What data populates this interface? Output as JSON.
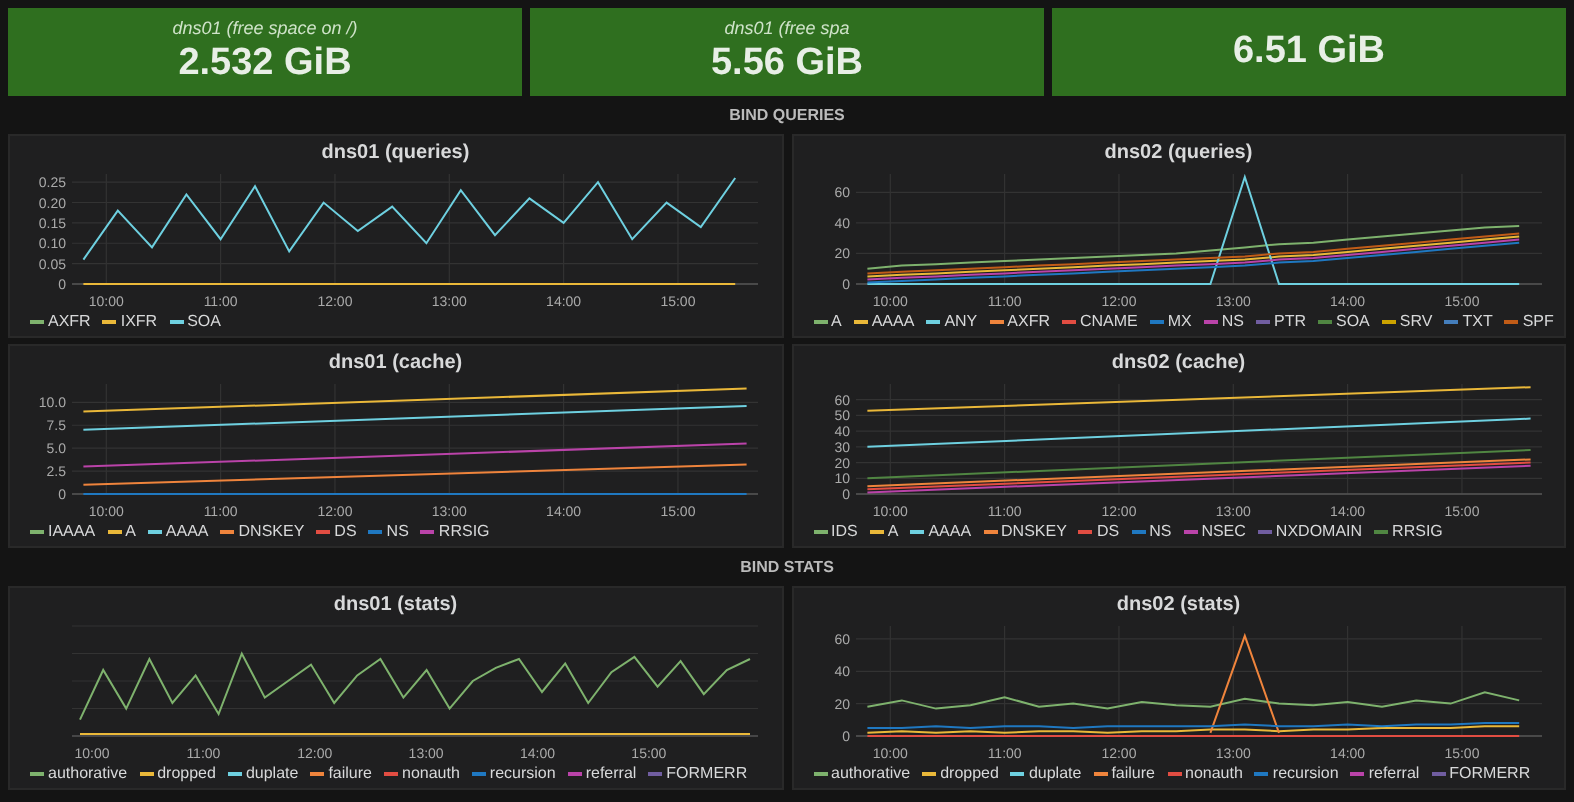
{
  "stat_panels": [
    {
      "title": "dns01 (free space on /)",
      "value": "2.532 GiB"
    },
    {
      "title": "dns01 (free spa",
      "value": "5.56 GiB"
    },
    {
      "value": "6.51 GiB"
    }
  ],
  "rows": [
    {
      "title": "BIND QUERIES",
      "panels": [
        {
          "chart_data": {
            "type": "line",
            "grid": true,
            "title": "dns01 (queries)",
            "x": [
              9.8,
              10.1,
              10.4,
              10.7,
              11,
              11.3,
              11.6,
              11.9,
              12.2,
              12.5,
              12.8,
              13.1,
              13.4,
              13.7,
              14,
              14.3,
              14.6,
              14.9,
              15.2,
              15.5
            ],
            "xlim": [
              9.7,
              15.7
            ],
            "ylim": [
              0,
              0.27
            ],
            "xticks": [
              {
                "value": 10,
                "label": "10:00"
              },
              {
                "value": 11,
                "label": "11:00"
              },
              {
                "value": 12,
                "label": "12:00"
              },
              {
                "value": 13,
                "label": "13:00"
              },
              {
                "value": 14,
                "label": "14:00"
              },
              {
                "value": 15,
                "label": "15:00"
              }
            ],
            "yticks": [
              0,
              {
                "value": 0.05,
                "label": "0.05"
              },
              {
                "value": 0.1,
                "label": "0.10"
              },
              {
                "value": 0.15,
                "label": "0.15"
              },
              {
                "value": 0.2,
                "label": "0.20"
              },
              {
                "value": 0.25,
                "label": "0.25"
              }
            ],
            "series": [
              {
                "name": "AXFR",
                "color": "#7eb26d",
                "values": [
                  null,
                  null,
                  null,
                  null,
                  null,
                  null,
                  null,
                  null,
                  null,
                  null,
                  null,
                  null,
                  null,
                  null,
                  null,
                  null,
                  null,
                  null,
                  null,
                  null
                ]
              },
              {
                "name": "IXFR",
                "color": "#eab839",
                "values": [
                  0,
                  0,
                  0,
                  0,
                  0,
                  0,
                  0,
                  0,
                  0,
                  0,
                  0,
                  0,
                  0,
                  0,
                  0,
                  0,
                  0,
                  0,
                  0,
                  0
                ]
              },
              {
                "name": "SOA",
                "color": "#6ed0e0",
                "values": [
                  0.06,
                  0.18,
                  0.09,
                  0.22,
                  0.11,
                  0.24,
                  0.08,
                  0.2,
                  0.13,
                  0.19,
                  0.1,
                  0.23,
                  0.12,
                  0.21,
                  0.15,
                  0.25,
                  0.11,
                  0.2,
                  0.14,
                  0.26
                ]
              }
            ]
          }
        },
        {
          "chart_data": {
            "type": "line",
            "grid": true,
            "title": "dns02 (queries)",
            "x": [
              9.8,
              10.1,
              10.4,
              10.7,
              11,
              11.3,
              11.6,
              11.9,
              12.2,
              12.5,
              12.8,
              13.1,
              13.4,
              13.7,
              14,
              14.3,
              14.6,
              14.9,
              15.2,
              15.5
            ],
            "xlim": [
              9.7,
              15.7
            ],
            "ylim": [
              0,
              72
            ],
            "xticks": [
              {
                "value": 10,
                "label": "10:00"
              },
              {
                "value": 11,
                "label": "11:00"
              },
              {
                "value": 12,
                "label": "12:00"
              },
              {
                "value": 13,
                "label": "13:00"
              },
              {
                "value": 14,
                "label": "14:00"
              },
              {
                "value": 15,
                "label": "15:00"
              }
            ],
            "yticks": [
              0,
              20,
              40,
              60
            ],
            "series": [
              {
                "name": "A",
                "color": "#7eb26d",
                "values": [
                  10,
                  12,
                  13,
                  14,
                  15,
                  16,
                  17,
                  18,
                  19,
                  20,
                  22,
                  24,
                  26,
                  27,
                  29,
                  31,
                  33,
                  35,
                  37,
                  38
                ]
              },
              {
                "name": "AAAA",
                "color": "#eab839",
                "values": [
                  5,
                  6,
                  7,
                  8,
                  9,
                  10,
                  11,
                  12,
                  13,
                  14,
                  15,
                  16,
                  18,
                  19,
                  21,
                  23,
                  25,
                  27,
                  29,
                  31
                ]
              },
              {
                "name": "ANY",
                "color": "#6ed0e0",
                "values": [
                  0,
                  0,
                  0,
                  0,
                  0,
                  0,
                  0,
                  0,
                  0,
                  0,
                  0,
                  70,
                  0,
                  0,
                  0,
                  0,
                  0,
                  0,
                  0,
                  0
                ]
              },
              {
                "name": "AXFR",
                "color": "#ef843c",
                "values": [
                  null,
                  null,
                  null,
                  null,
                  null,
                  null,
                  null,
                  null,
                  null,
                  null,
                  null,
                  null,
                  null,
                  null,
                  null,
                  null,
                  null,
                  null,
                  null,
                  null
                ]
              },
              {
                "name": "CNAME",
                "color": "#e24d42",
                "values": [
                  null,
                  null,
                  null,
                  null,
                  null,
                  null,
                  null,
                  null,
                  null,
                  null,
                  null,
                  null,
                  null,
                  null,
                  null,
                  null,
                  null,
                  null,
                  null,
                  null
                ]
              },
              {
                "name": "MX",
                "color": "#1f78c1",
                "values": [
                  1,
                  2,
                  3,
                  4,
                  5,
                  6,
                  7,
                  8,
                  9,
                  10,
                  11,
                  12,
                  14,
                  15,
                  17,
                  19,
                  21,
                  23,
                  25,
                  27
                ]
              },
              {
                "name": "NS",
                "color": "#ba43a9",
                "values": [
                  3,
                  4,
                  5,
                  6,
                  7,
                  8,
                  9,
                  10,
                  11,
                  12,
                  13,
                  14,
                  16,
                  17,
                  19,
                  21,
                  23,
                  25,
                  27,
                  29
                ]
              },
              {
                "name": "PTR",
                "color": "#705da0",
                "values": [
                  null,
                  null,
                  null,
                  null,
                  null,
                  null,
                  null,
                  null,
                  null,
                  null,
                  null,
                  null,
                  null,
                  null,
                  null,
                  null,
                  null,
                  null,
                  null,
                  null
                ]
              },
              {
                "name": "SOA",
                "color": "#508642",
                "values": [
                  null,
                  null,
                  null,
                  null,
                  null,
                  null,
                  null,
                  null,
                  null,
                  null,
                  null,
                  null,
                  null,
                  null,
                  null,
                  null,
                  null,
                  null,
                  null,
                  null
                ]
              },
              {
                "name": "SRV",
                "color": "#cca300",
                "values": [
                  null,
                  null,
                  null,
                  null,
                  null,
                  null,
                  null,
                  null,
                  null,
                  null,
                  null,
                  null,
                  null,
                  null,
                  null,
                  null,
                  null,
                  null,
                  null,
                  null
                ]
              },
              {
                "name": "TXT",
                "color": "#447ebc",
                "values": [
                  null,
                  null,
                  null,
                  null,
                  null,
                  null,
                  null,
                  null,
                  null,
                  null,
                  null,
                  null,
                  null,
                  null,
                  null,
                  null,
                  null,
                  null,
                  null,
                  null
                ]
              },
              {
                "name": "SPF",
                "color": "#c15c17",
                "values": [
                  7,
                  8,
                  9,
                  10,
                  11,
                  12,
                  13,
                  14,
                  15,
                  16,
                  17,
                  18,
                  20,
                  21,
                  23,
                  25,
                  27,
                  29,
                  31,
                  33
                ]
              }
            ]
          }
        }
      ]
    },
    {
      "panels": [
        {
          "chart_data": {
            "type": "line",
            "grid": true,
            "title": "dns01 (cache)",
            "x": [
              9.8,
              15.6
            ],
            "xlim": [
              9.7,
              15.7
            ],
            "ylim": [
              0,
              12
            ],
            "xticks": [
              {
                "value": 10,
                "label": "10:00"
              },
              {
                "value": 11,
                "label": "11:00"
              },
              {
                "value": 12,
                "label": "12:00"
              },
              {
                "value": 13,
                "label": "13:00"
              },
              {
                "value": 14,
                "label": "14:00"
              },
              {
                "value": 15,
                "label": "15:00"
              }
            ],
            "yticks": [
              0,
              {
                "value": 2.5,
                "label": "2.5"
              },
              {
                "value": 5,
                "label": "5.0"
              },
              {
                "value": 7.5,
                "label": "7.5"
              },
              {
                "value": 10,
                "label": "10.0"
              }
            ],
            "series": [
              {
                "name": "IAAAA",
                "color": "#7eb26d",
                "values": [
                  null,
                  null
                ]
              },
              {
                "name": "A",
                "color": "#eab839",
                "values": [
                  9,
                  11.5
                ]
              },
              {
                "name": "AAAA",
                "color": "#6ed0e0",
                "values": [
                  7,
                  9.6
                ]
              },
              {
                "name": "DNSKEY",
                "color": "#ef843c",
                "values": [
                  1,
                  3.2
                ]
              },
              {
                "name": "DS",
                "color": "#e24d42",
                "values": [
                  null,
                  null
                ]
              },
              {
                "name": "NS",
                "color": "#1f78c1",
                "values": [
                  0,
                  0
                ]
              },
              {
                "name": "RRSIG",
                "color": "#ba43a9",
                "values": [
                  3,
                  5.5
                ]
              }
            ]
          }
        },
        {
          "chart_data": {
            "type": "line",
            "grid": true,
            "title": "dns02 (cache)",
            "x": [
              9.8,
              15.6
            ],
            "xlim": [
              9.7,
              15.7
            ],
            "ylim": [
              0,
              70
            ],
            "xticks": [
              {
                "value": 10,
                "label": "10:00"
              },
              {
                "value": 11,
                "label": "11:00"
              },
              {
                "value": 12,
                "label": "12:00"
              },
              {
                "value": 13,
                "label": "13:00"
              },
              {
                "value": 14,
                "label": "14:00"
              },
              {
                "value": 15,
                "label": "15:00"
              }
            ],
            "yticks": [
              0,
              10,
              20,
              30,
              40,
              50,
              60
            ],
            "series": [
              {
                "name": "IDS",
                "color": "#7eb26d",
                "values": [
                  null,
                  null
                ]
              },
              {
                "name": "A",
                "color": "#eab839",
                "values": [
                  53,
                  68
                ]
              },
              {
                "name": "AAAA",
                "color": "#6ed0e0",
                "values": [
                  30,
                  48
                ]
              },
              {
                "name": "DNSKEY",
                "color": "#ef843c",
                "values": [
                  5,
                  22
                ]
              },
              {
                "name": "DS",
                "color": "#e24d42",
                "values": [
                  3,
                  20
                ]
              },
              {
                "name": "NS",
                "color": "#1f78c1",
                "values": [
                  null,
                  null
                ]
              },
              {
                "name": "NSEC",
                "color": "#ba43a9",
                "values": [
                  1,
                  18
                ]
              },
              {
                "name": "NXDOMAIN",
                "color": "#705da0",
                "values": [
                  null,
                  null
                ]
              },
              {
                "name": "RRSIG",
                "color": "#508642",
                "values": [
                  10,
                  28
                ]
              }
            ]
          }
        }
      ]
    },
    {
      "title": "BIND STATS",
      "panels": [
        {
          "title": "dns01 (stats)",
          "x_labels": [
            "10:00",
            "11:00",
            "12:00",
            "13:00",
            "14:00",
            "15:00"
          ],
          "legend": [
            {
              "name": "authorative",
              "color": "#7eb26d"
            },
            {
              "name": "dropped",
              "color": "#eab839"
            },
            {
              "name": "duplate",
              "color": "#6ed0e0"
            },
            {
              "name": "failure",
              "color": "#ef843c"
            },
            {
              "name": "nonauth",
              "color": "#e24d42"
            },
            {
              "name": "recursion",
              "color": "#1f78c1"
            },
            {
              "name": "referral",
              "color": "#ba43a9"
            },
            {
              "name": "FORMERR",
              "color": "#705da0"
            }
          ]
        },
        {
          "chart_data": {
            "type": "line",
            "grid": true,
            "title": "dns02 (stats)",
            "x": [
              9.8,
              10.1,
              10.4,
              10.7,
              11,
              11.3,
              11.6,
              11.9,
              12.2,
              12.5,
              12.8,
              13.1,
              13.4,
              13.7,
              14,
              14.3,
              14.6,
              14.9,
              15.2,
              15.5
            ],
            "xlim": [
              9.7,
              15.7
            ],
            "ylim": [
              0,
              68
            ],
            "xticks": [
              {
                "value": 10,
                "label": "10:00"
              },
              {
                "value": 11,
                "label": "11:00"
              },
              {
                "value": 12,
                "label": "12:00"
              },
              {
                "value": 13,
                "label": "13:00"
              },
              {
                "value": 14,
                "label": "14:00"
              },
              {
                "value": 15,
                "label": "15:00"
              }
            ],
            "yticks": [
              0,
              20,
              40,
              60
            ],
            "series": [
              {
                "name": "authorative",
                "color": "#7eb26d",
                "values": [
                  18,
                  22,
                  17,
                  19,
                  24,
                  18,
                  20,
                  17,
                  21,
                  19,
                  18,
                  23,
                  20,
                  19,
                  21,
                  18,
                  22,
                  20,
                  27,
                  22
                ]
              },
              {
                "name": "dropped",
                "color": "#eab839",
                "values": [
                  2,
                  3,
                  2,
                  3,
                  2,
                  3,
                  3,
                  2,
                  3,
                  3,
                  4,
                  4,
                  3,
                  4,
                  4,
                  5,
                  5,
                  5,
                  6,
                  6
                ]
              },
              {
                "name": "duplate",
                "color": "#6ed0e0",
                "values": [
                  null,
                  null,
                  null,
                  null,
                  null,
                  null,
                  null,
                  null,
                  null,
                  null,
                  null,
                  null,
                  null,
                  null,
                  null,
                  null,
                  null,
                  null,
                  null,
                  null
                ]
              },
              {
                "name": "failure",
                "color": "#ef843c",
                "values": [
                  null,
                  null,
                  null,
                  null,
                  null,
                  null,
                  null,
                  null,
                  null,
                  null,
                  2,
                  62,
                  2,
                  null,
                  null,
                  null,
                  null,
                  null,
                  null,
                  null
                ]
              },
              {
                "name": "nonauth",
                "color": "#e24d42",
                "values": [
                  0,
                  0,
                  0,
                  0,
                  0,
                  0,
                  0,
                  0,
                  0,
                  0,
                  0,
                  0,
                  0,
                  0,
                  0,
                  0,
                  0,
                  0,
                  0,
                  0
                ]
              },
              {
                "name": "recursion",
                "color": "#1f78c1",
                "values": [
                  5,
                  5,
                  6,
                  5,
                  6,
                  6,
                  5,
                  6,
                  6,
                  6,
                  6,
                  7,
                  6,
                  6,
                  7,
                  6,
                  7,
                  7,
                  8,
                  8
                ]
              },
              {
                "name": "referral",
                "color": "#ba43a9",
                "values": [
                  null,
                  null,
                  null,
                  null,
                  null,
                  null,
                  null,
                  null,
                  null,
                  null,
                  null,
                  null,
                  null,
                  null,
                  null,
                  null,
                  null,
                  null,
                  null,
                  null
                ]
              },
              {
                "name": "FORMERR",
                "color": "#705da0",
                "values": [
                  null,
                  null,
                  null,
                  null,
                  null,
                  null,
                  null,
                  null,
                  null,
                  null,
                  null,
                  null,
                  null,
                  null,
                  null,
                  null,
                  null,
                  null,
                  null,
                  null
                ]
              }
            ]
          }
        }
      ]
    }
  ]
}
